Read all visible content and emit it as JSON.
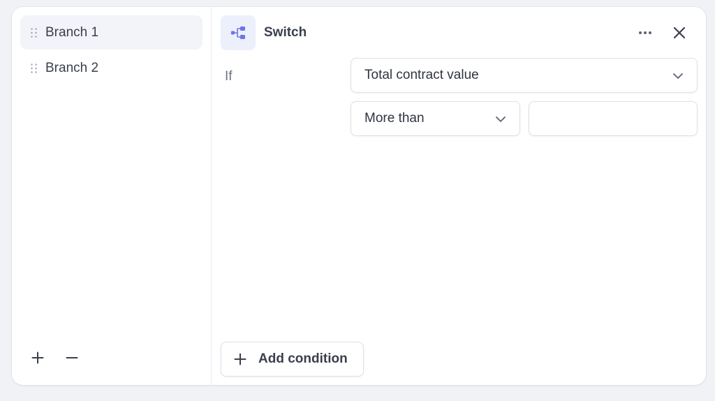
{
  "sidebar": {
    "items": [
      {
        "label": "Branch 1",
        "active": true
      },
      {
        "label": "Branch 2",
        "active": false
      }
    ],
    "add_icon": "plus-icon",
    "remove_icon": "minus-icon"
  },
  "header": {
    "icon": "flow-split-icon",
    "title": "Switch",
    "more_icon": "more-horizontal-icon",
    "close_icon": "close-icon"
  },
  "condition": {
    "if_label": "If",
    "field": {
      "value": "Total contract value"
    },
    "operator": {
      "value": "More than"
    },
    "value_input": {
      "value": "",
      "placeholder": ""
    }
  },
  "footer": {
    "add_condition_label": "Add condition"
  },
  "colors": {
    "accent": "#6d74e8",
    "icon_bg": "#eceffc",
    "active_bg": "#f3f4f9",
    "border": "#dde0e8"
  }
}
